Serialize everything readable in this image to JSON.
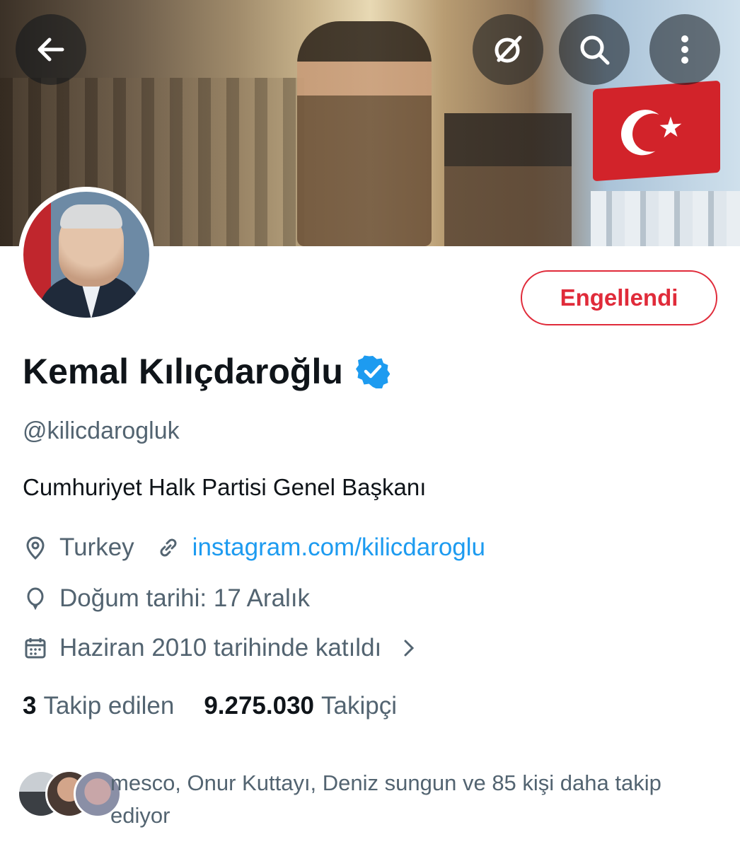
{
  "header": {
    "back_icon": "arrow-left-icon",
    "grok_icon": "grok-icon",
    "search_icon": "search-icon",
    "more_icon": "more-vertical-icon"
  },
  "profile": {
    "name": "Kemal Kılıçdaroğlu",
    "handle": "@kilicdarogluk",
    "bio": "Cumhuriyet Halk Partisi Genel Başkanı",
    "location": "Turkey",
    "website": "instagram.com/kilicdaroglu",
    "birthday": "Doğum tarihi: 17 Aralık",
    "joined": "Haziran 2010 tarihinde katıldı",
    "blocked_button_label": "Engellendi",
    "verified": true
  },
  "stats": {
    "following_count": "3",
    "following_label": "Takip edilen",
    "followers_count": "9.275.030",
    "followers_label": "Takipçi"
  },
  "followed_by": {
    "text": "mesco, Onur Kuttayı, Deniz sungun ve 85 kişi daha takip ediyor"
  },
  "colors": {
    "accent_link": "#1d9bf0",
    "blocked_red": "#e02b3a",
    "verified_blue": "#1d9bf0",
    "secondary_text": "#536471"
  }
}
